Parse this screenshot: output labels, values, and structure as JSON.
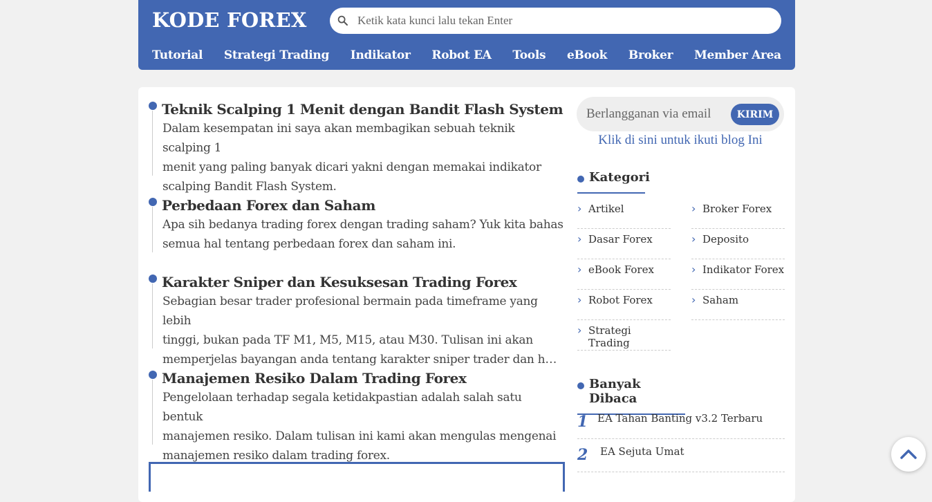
{
  "header": {
    "logo": "KODE FOREX",
    "search_placeholder": "Ketik kata kunci lalu tekan Enter",
    "nav": [
      "Tutorial",
      "Strategi Trading",
      "Indikator",
      "Robot EA",
      "Tools",
      "eBook",
      "Broker",
      "Member Area"
    ]
  },
  "posts": [
    {
      "title": "Teknik Scalping 1 Menit dengan Bandit Flash System",
      "excerpt": [
        "Dalam kesempatan ini saya akan membagikan sebuah teknik scalping 1",
        "menit yang paling banyak dicari yakni dengan memakai indikator",
        "scalping Bandit Flash System."
      ]
    },
    {
      "title": "Perbedaan Forex dan Saham",
      "excerpt": [
        "Apa sih bedanya trading forex dengan trading saham? Yuk kita bahas",
        "semua hal tentang perbedaan forex dan saham ini."
      ]
    },
    {
      "title": "Karakter Sniper dan Kesuksesan Trading Forex",
      "excerpt": [
        "Sebagian besar trader profesional bermain pada timeframe yang lebih",
        "tinggi, bukan pada TF M1, M5, M15, atau M30. Tulisan ini akan",
        "memperjelas bayangan anda tentang karakter sniper trader dan hubungannya"
      ]
    },
    {
      "title": "Manajemen Resiko Dalam Trading Forex",
      "excerpt": [
        "Pengelolaan terhadap segala ketidakpastian adalah salah satu bentuk",
        "manajemen resiko. Dalam tulisan ini kami akan mengulas mengenai",
        "manajemen resiko dalam trading forex."
      ]
    }
  ],
  "sidebar": {
    "subscribe_placeholder": "Berlangganan via email",
    "subscribe_button": "KIRIM",
    "follow_link": "Klik di sini untuk ikuti blog Ini",
    "kategori_title": "Kategori",
    "categories": [
      "Artikel",
      "Broker Forex",
      "Dasar Forex",
      "Deposito",
      "eBook Forex",
      "Indikator Forex",
      "Robot Forex",
      "Saham",
      "Strategi Trading"
    ],
    "popular_title": "Banyak Dibaca",
    "popular": [
      {
        "num": "1",
        "title": "EA Tahan Banting v3.2 Terbaru"
      },
      {
        "num": "2",
        "title": "EA Sejuta Umat"
      }
    ]
  },
  "colors": {
    "accent": "#4267b2",
    "page_bg": "#f1f1f1"
  },
  "icons": {
    "search": "search-icon",
    "totop": "chevron-up-icon",
    "category": "chevron-right-icon"
  }
}
